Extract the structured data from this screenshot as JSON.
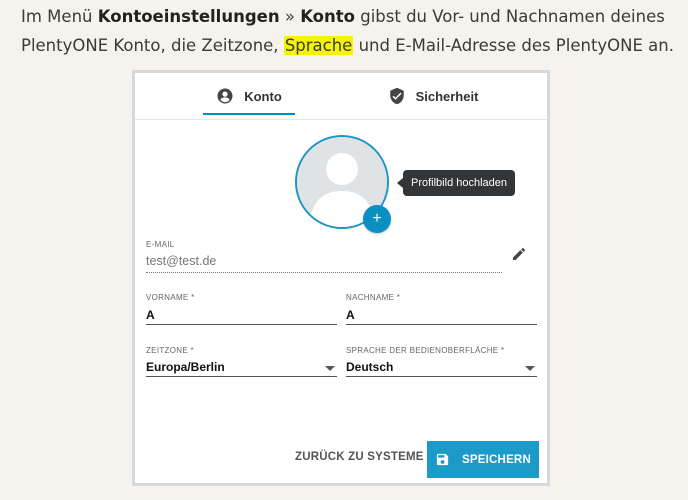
{
  "intro": {
    "part1": "Im Menü ",
    "bold1": "Kontoeinstellungen",
    "sep": " » ",
    "bold2": "Konto",
    "part2": " gibst du Vor- und Nachnamen deines PlentyONE Konto, die Zeitzone, ",
    "highlight": "Sprache",
    "part3": " und E-Mail-Adresse des PlentyONE an."
  },
  "tabs": [
    {
      "label": "Konto",
      "icon": "account-circle-icon",
      "active": true
    },
    {
      "label": "Sicherheit",
      "icon": "shield-check-icon",
      "active": false
    }
  ],
  "avatar": {
    "tooltip": "Profilbild hochladen",
    "add_symbol": "+"
  },
  "form": {
    "email": {
      "label": "E-Mail",
      "value": "test@test.de"
    },
    "vorname": {
      "label": "Vorname *",
      "value": "A"
    },
    "nachname": {
      "label": "Nachname *",
      "value": "A"
    },
    "zeitzone": {
      "label": "Zeitzone *",
      "value": "Europa/Berlin"
    },
    "sprache": {
      "label": "Sprache der Bedienoberfläche *",
      "value": "Deutsch"
    }
  },
  "actions": {
    "back_label": "ZURÜCK ZU SYSTEME",
    "save_label": "SPEICHERN"
  },
  "colors": {
    "accent": "#1c9ac8",
    "highlight": "#f6f500",
    "tooltip_bg": "#333638"
  }
}
